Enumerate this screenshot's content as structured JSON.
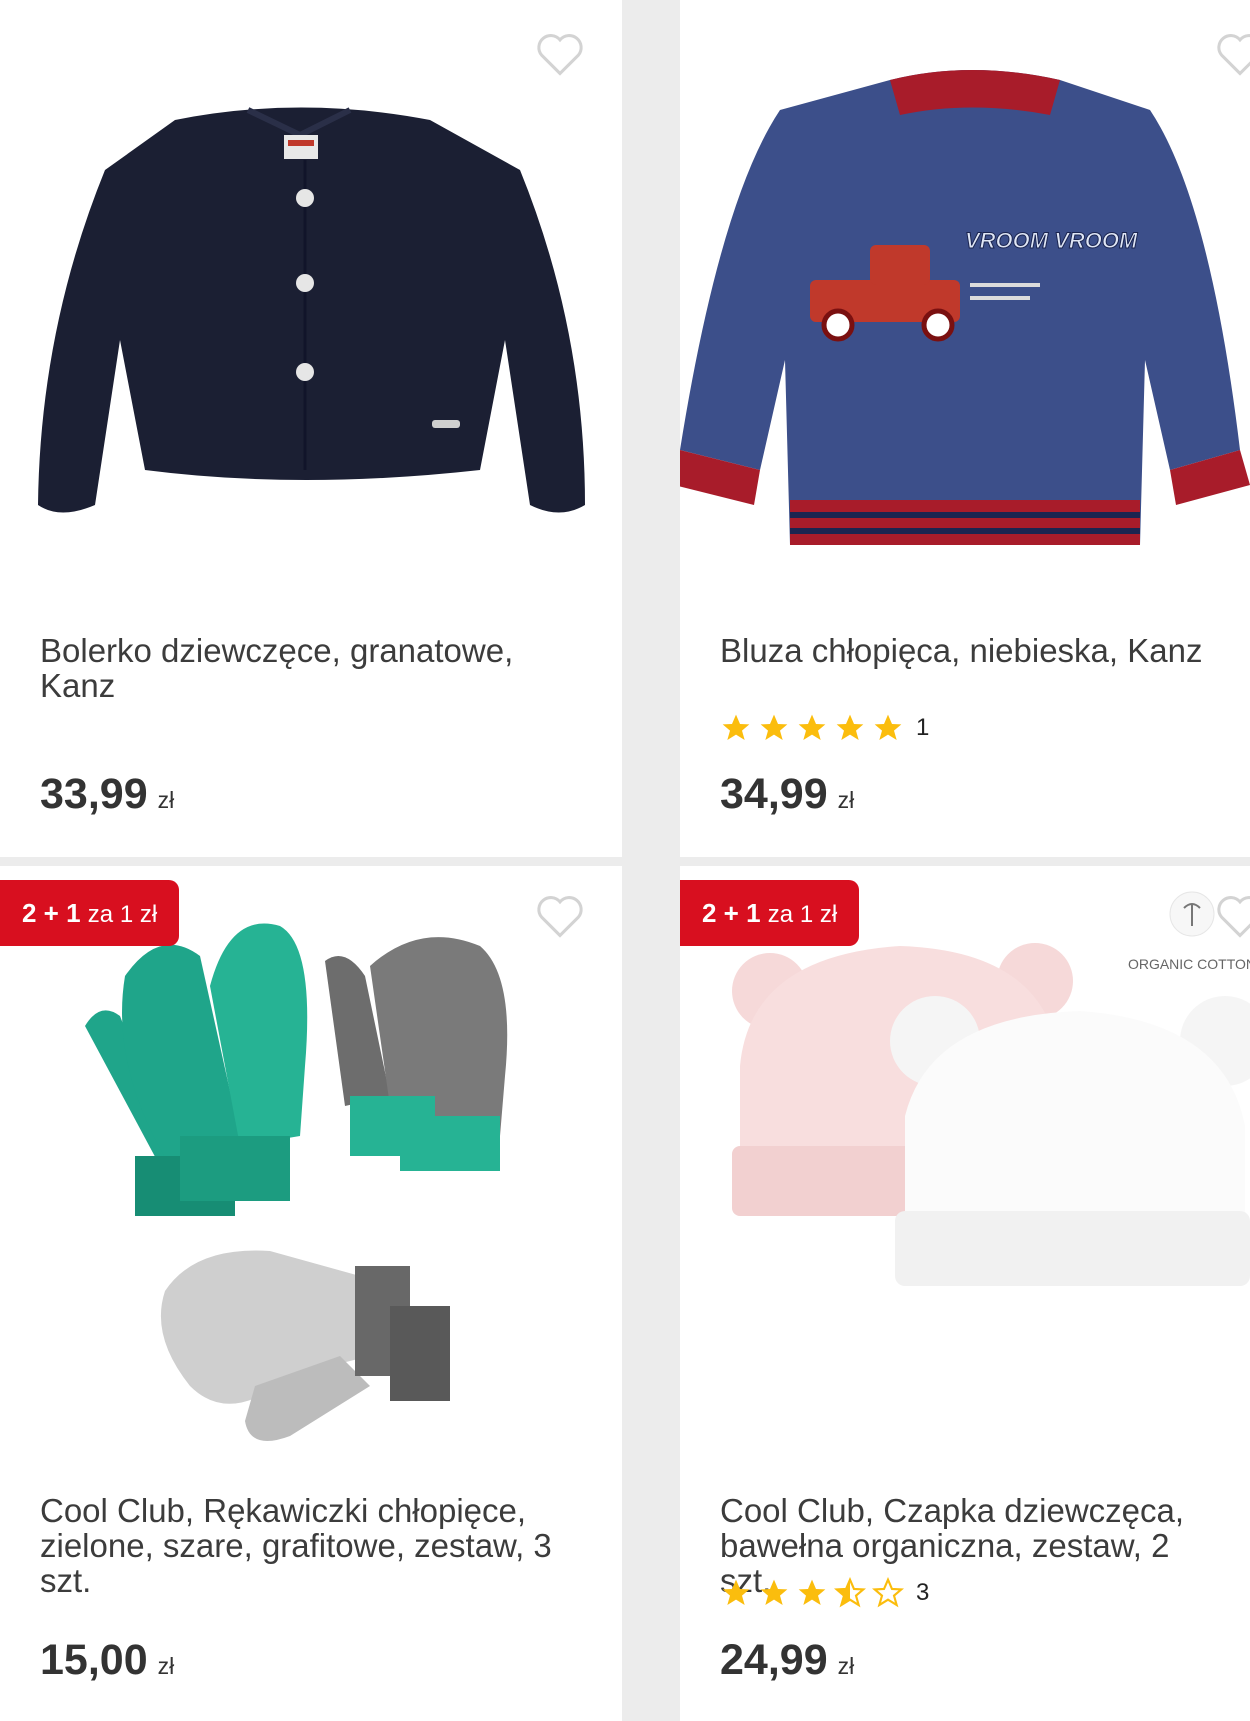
{
  "products": [
    {
      "title": "Bolerko dziewczęce, granatowe, Kanz",
      "price": "33,99",
      "currency": "zł"
    },
    {
      "title": "Bluza chłopięca, niebieska, Kanz",
      "rating": 5,
      "review_count": "1",
      "price": "34,99",
      "currency": "zł",
      "image_text": "VROOM VROOM"
    },
    {
      "badge": {
        "main": "2 + 1",
        "suffix": "za 1 zł"
      },
      "title": "Cool Club, Rękawiczki chłopięce, zielone, szare, grafitowe, zestaw, 3 szt.",
      "price": "15,00",
      "currency": "zł"
    },
    {
      "badge": {
        "main": "2 + 1",
        "suffix": "za 1 zł"
      },
      "title": "Cool Club, Czapka dziewczęca, bawełna organiczna, zestaw, 2 szt.",
      "rating": 3.5,
      "review_count": "3",
      "price": "24,99",
      "currency": "zł",
      "image_text": "ORGANIC COTTON"
    }
  ],
  "colors": {
    "accent_red": "#d80f1f",
    "star": "#fbbd0d",
    "price_text": "#333333",
    "title_text": "#3c3c3c",
    "grid_gap": "#ececec"
  },
  "icons": [
    "heart-outline-icon",
    "star-icon",
    "star-half-icon",
    "star-outline-icon"
  ]
}
